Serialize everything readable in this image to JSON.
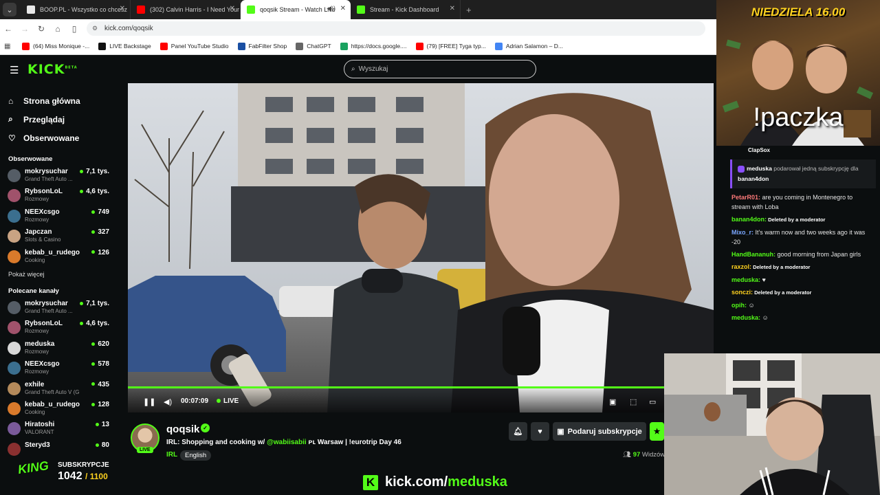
{
  "browser": {
    "tabs": [
      {
        "title": "BOOP.PL - Wszystko co chcesz",
        "color": "#e8e8e8"
      },
      {
        "title": "(302) Calvin Harris - I Need Your",
        "color": "#ff0000"
      },
      {
        "title": "qoqsik Stream - Watch Live",
        "color": "#53fc18"
      },
      {
        "title": "Stream - Kick Dashboard",
        "color": "#53fc18"
      }
    ],
    "url": "kick.com/qoqsik",
    "bookmarks": [
      {
        "label": "(64) Miss Monique -...",
        "color": "#ff0000"
      },
      {
        "label": "LIVE Backstage",
        "color": "#111111"
      },
      {
        "label": "Panel YouTube Studio",
        "color": "#ff0000"
      },
      {
        "label": "FabFilter Shop",
        "color": "#1a4fa3"
      },
      {
        "label": "ChatGPT",
        "color": "#666666"
      },
      {
        "label": "https://docs.google....",
        "color": "#1aa260"
      },
      {
        "label": "(79) [FREE] Tyga typ...",
        "color": "#ff0000"
      },
      {
        "label": "Adrian Salamon – D...",
        "color": "#4285f4"
      }
    ]
  },
  "kick": {
    "logo": "KICK",
    "logo_beta": "BETA",
    "search_placeholder": "Wyszukaj",
    "nav": [
      {
        "icon": "⌂",
        "label": "Strona główna"
      },
      {
        "icon": "⌕",
        "label": "Przeglądaj"
      },
      {
        "icon": "♡",
        "label": "Obserwowane"
      }
    ],
    "followed_title": "Obserwowane",
    "followed": [
      {
        "name": "mokrysuchar",
        "game": "Grand Theft Auto ...",
        "viewers": "7,1 tys.",
        "color": "#555d66"
      },
      {
        "name": "RybsonLoL",
        "game": "Rozmowy",
        "viewers": "4,6 tys.",
        "color": "#a0526b"
      },
      {
        "name": "NEEXcsgo",
        "game": "Rozmowy",
        "viewers": "749",
        "color": "#3b6f8f"
      },
      {
        "name": "Japczan",
        "game": "Slots & Casino",
        "viewers": "327",
        "color": "#c9a383"
      },
      {
        "name": "kebab_u_rudego",
        "game": "Cooking",
        "viewers": "126",
        "color": "#d97a2b"
      }
    ],
    "show_more": "Pokaż więcej",
    "recommended_title": "Polecane kanały",
    "recommended": [
      {
        "name": "mokrysuchar",
        "game": "Grand Theft Auto ...",
        "viewers": "7,1 tys.",
        "color": "#555d66"
      },
      {
        "name": "RybsonLoL",
        "game": "Rozmowy",
        "viewers": "4,6 tys.",
        "color": "#a0526b"
      },
      {
        "name": "meduska",
        "game": "Rozmowy",
        "viewers": "620",
        "color": "#d8d8d8"
      },
      {
        "name": "NEEXcsgo",
        "game": "Rozmowy",
        "viewers": "578",
        "color": "#3b6f8f"
      },
      {
        "name": "exhile",
        "game": "Grand Theft Auto V (G...",
        "viewers": "435",
        "color": "#b48a5a"
      },
      {
        "name": "kebab_u_rudego",
        "game": "Cooking",
        "viewers": "128",
        "color": "#d97a2b"
      },
      {
        "name": "Hiratoshi",
        "game": "VALORANT",
        "viewers": "13",
        "color": "#7a5a9a"
      },
      {
        "name": "Steryd3",
        "game": "",
        "viewers": "80",
        "color": "#8a3030"
      }
    ]
  },
  "player": {
    "time": "00:07:09",
    "live": "LIVE",
    "progress": 0.915
  },
  "stream": {
    "streamer": "qoqsik",
    "live_badge": "LIVE",
    "title_pre": "IRL: Shopping and cooking w/ ",
    "title_mention": "@wabiisabii",
    "title_post": " ᴘʟ Warsaw | !eurotrip Day 46",
    "category": "IRL",
    "tag": "English",
    "gift_sub_label": "Podaruj subskrypcje",
    "viewers_count": "97",
    "viewers_label": "Widzów"
  },
  "overlay": {
    "thumb_title": "NIEDZIELA 16.00",
    "thumb_big": "!paczka",
    "sub_logo": "KING",
    "sub_label": "SUBSKRYPCJE",
    "sub_count": "1042",
    "sub_goal": "/ 1100",
    "promo_pre": "kick.com/",
    "promo_name": "meduska"
  },
  "chat": {
    "top_user": "ClapSox",
    "gift_user": "meduska",
    "gift_text": " podarował jedną subskrypcję dla",
    "gift_target": "banan4don",
    "messages": [
      {
        "user": "PetarR01",
        "color": "#ff7a7a",
        "text": " are you coming in Montenegro to stream with Loba",
        "small": false
      },
      {
        "user": "banan4don",
        "color": "#53fc18",
        "text": " Deleted by a moderator",
        "small": true
      },
      {
        "user": "Mixo_r",
        "color": "#7aa7ff",
        "text": " It's warm now and two weeks ago it was -20",
        "small": false
      },
      {
        "user": "HandBananuh",
        "color": "#53fc18",
        "text": " good morning from Japan girls",
        "small": false
      },
      {
        "user": "raxzol",
        "color": "#ffd21f",
        "text": " Deleted by a moderator",
        "small": true
      },
      {
        "user": "meduska",
        "color": "#53fc18",
        "text": " ♥",
        "small": false
      },
      {
        "user": "sonczi",
        "color": "#ffd21f",
        "text": " Deleted by a moderator",
        "small": true
      },
      {
        "user": "opih",
        "color": "#53fc18",
        "text": " ☺",
        "small": false
      },
      {
        "user": "meduska",
        "color": "#53fc18",
        "text": " ☺",
        "small": false
      }
    ]
  },
  "colors": {
    "accent": "#53fc18",
    "bg": "#0b0e0f",
    "panel": "#2b2f31"
  }
}
